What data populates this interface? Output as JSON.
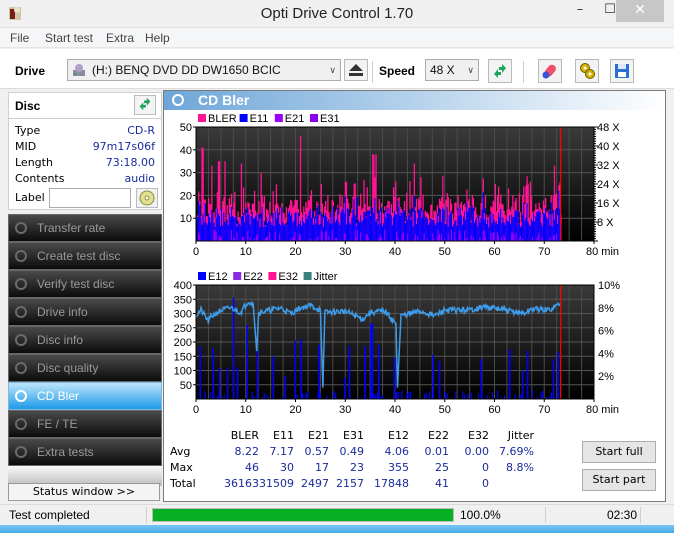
{
  "window": {
    "title": "Opti Drive Control 1.70",
    "minimize": "–",
    "maximize": "☐",
    "close": "✕"
  },
  "menu": [
    "File",
    "Start test",
    "Extra",
    "Help"
  ],
  "toolbar": {
    "drive_label": "Drive",
    "drive_value": "(H:)  BENQ DVD DD DW1650 BCIC",
    "speed_label": "Speed",
    "speed_value": "48 X"
  },
  "disc": {
    "header": "Disc",
    "rows": [
      {
        "key": "Type",
        "value": "CD-R"
      },
      {
        "key": "MID",
        "value": "97m17s06f"
      },
      {
        "key": "Length",
        "value": "73:18.00"
      },
      {
        "key": "Contents",
        "value": "audio"
      }
    ],
    "label_key": "Label",
    "label_value": ""
  },
  "nav": [
    {
      "label": "Transfer rate",
      "active": false
    },
    {
      "label": "Create test disc",
      "active": false
    },
    {
      "label": "Verify test disc",
      "active": false
    },
    {
      "label": "Drive info",
      "active": false
    },
    {
      "label": "Disc info",
      "active": false
    },
    {
      "label": "Disc quality",
      "active": false
    },
    {
      "label": "CD Bler",
      "active": true
    },
    {
      "label": "FE / TE",
      "active": false
    },
    {
      "label": "Extra tests",
      "active": false
    }
  ],
  "status_window_button": "Status window >>",
  "panel_title": "CD Bler",
  "colors": {
    "bler": "#ff1493",
    "e11": "#0000ff",
    "e21": "#9900ff",
    "e31": "#8800ee",
    "e12": "#0000ff",
    "e22": "#8a2be2",
    "e32": "#ff1493",
    "jitter": "#3d9be9",
    "jitter_legend": "#3b7f7f",
    "marker": "#ff0000",
    "progress": "#06b025"
  },
  "chart_data": [
    {
      "type": "bar",
      "title": "CD Bler - upper",
      "legend": [
        "BLER",
        "E11",
        "E21",
        "E31"
      ],
      "legend_placement": "top-left",
      "xlabel": "min",
      "x_ticks": [
        "0",
        "10",
        "20",
        "30",
        "40",
        "50",
        "60",
        "70",
        "80 min"
      ],
      "xlim": [
        0,
        80
      ],
      "y_ticks_left": [
        "10",
        "20",
        "30",
        "40",
        "50"
      ],
      "ylim_left": [
        0,
        50
      ],
      "y_ticks_right": [
        "8 X",
        "16 X",
        "24 X",
        "32 X",
        "40 X",
        "48 X"
      ],
      "ylim_right": [
        0,
        48
      ],
      "end_marker_min": 73.3,
      "grid": true,
      "series_summary": {
        "BLER_max": 46,
        "E11_max": 30,
        "E21_max": 17,
        "E31_max": 23,
        "BLER_avg": 8.22,
        "E11_avg": 7.17
      },
      "bler_peaks": [
        [
          1.2,
          41
        ],
        [
          3,
          33
        ],
        [
          4.5,
          35
        ],
        [
          5.8,
          35
        ],
        [
          9,
          34
        ],
        [
          13,
          30
        ],
        [
          20.8,
          46
        ],
        [
          30,
          26
        ],
        [
          35.5,
          38
        ],
        [
          36,
          38
        ],
        [
          45,
          28
        ],
        [
          60,
          25
        ],
        [
          67,
          26
        ],
        [
          72,
          33
        ]
      ]
    },
    {
      "type": "bar",
      "title": "CD Bler - lower",
      "legend": [
        "E12",
        "E22",
        "E32",
        "Jitter"
      ],
      "legend_placement": "top-left",
      "xlabel": "min",
      "x_ticks": [
        "0",
        "10",
        "20",
        "30",
        "40",
        "50",
        "60",
        "70",
        "80 min"
      ],
      "xlim": [
        0,
        80
      ],
      "y_ticks_left": [
        "50",
        "100",
        "150",
        "200",
        "250",
        "300",
        "350",
        "400"
      ],
      "ylim_left": [
        0,
        400
      ],
      "y_ticks_right": [
        "2%",
        "4%",
        "6%",
        "8%",
        "10%"
      ],
      "ylim_right": [
        0,
        10
      ],
      "end_marker_min": 73.3,
      "grid": true,
      "e12_spikes": [
        [
          0.7,
          185
        ],
        [
          3.3,
          178
        ],
        [
          4.6,
          110
        ],
        [
          6.2,
          110
        ],
        [
          7.4,
          355
        ],
        [
          8.2,
          110
        ],
        [
          10.1,
          260
        ],
        [
          12.2,
          170
        ],
        [
          15.4,
          150
        ],
        [
          17.8,
          80
        ],
        [
          19.8,
          205
        ],
        [
          21.0,
          210
        ],
        [
          24.6,
          190
        ],
        [
          29.8,
          75
        ],
        [
          30.7,
          185
        ],
        [
          33.8,
          185
        ],
        [
          35.0,
          265
        ],
        [
          35.3,
          265
        ],
        [
          36.6,
          190
        ],
        [
          39.7,
          145
        ],
        [
          47.5,
          155
        ],
        [
          48.8,
          135
        ],
        [
          57.2,
          140
        ],
        [
          62.9,
          175
        ],
        [
          65.5,
          100
        ],
        [
          66.5,
          170
        ],
        [
          71.7,
          140
        ],
        [
          72.6,
          165
        ]
      ],
      "jitter_percent": [
        [
          0,
          7.3
        ],
        [
          1,
          7.8
        ],
        [
          2.5,
          6.8
        ],
        [
          3,
          7.2
        ],
        [
          5,
          7.8
        ],
        [
          7,
          8.0
        ],
        [
          9,
          7.6
        ],
        [
          10.5,
          8.6
        ],
        [
          11.5,
          8.3
        ],
        [
          12.2,
          4.2
        ],
        [
          12.6,
          7.6
        ],
        [
          15,
          7.8
        ],
        [
          17,
          8.0
        ],
        [
          19,
          7.5
        ],
        [
          21,
          8.0
        ],
        [
          23,
          8.2
        ],
        [
          25,
          7.8
        ],
        [
          25.5,
          1.0
        ],
        [
          25.9,
          7.6
        ],
        [
          30,
          7.7
        ],
        [
          33.5,
          7.0
        ],
        [
          35,
          7.6
        ],
        [
          38,
          7.7
        ],
        [
          40.2,
          6.6
        ],
        [
          40.5,
          1.0
        ],
        [
          41.2,
          7.3
        ],
        [
          45,
          7.7
        ],
        [
          48,
          7.3
        ],
        [
          50,
          7.8
        ],
        [
          55,
          7.8
        ],
        [
          58,
          8.1
        ],
        [
          62,
          7.8
        ],
        [
          66,
          7.5
        ],
        [
          67.5,
          7.9
        ],
        [
          71,
          7.8
        ],
        [
          73.3,
          8.4
        ]
      ],
      "series_summary": {
        "E12_max": 355,
        "E22_max": 25,
        "E32_max": 0,
        "Jitter_avg_percent": 7.69,
        "Jitter_max_percent": 8.8
      }
    }
  ],
  "stats": {
    "columns": [
      "BLER",
      "E11",
      "E21",
      "E31",
      "E12",
      "E22",
      "E32",
      "Jitter"
    ],
    "rows": [
      {
        "label": "Avg",
        "values": [
          "8.22",
          "7.17",
          "0.57",
          "0.49",
          "4.06",
          "0.01",
          "0.00",
          "7.69%"
        ]
      },
      {
        "label": "Max",
        "values": [
          "46",
          "30",
          "17",
          "23",
          "355",
          "25",
          "0",
          "8.8%"
        ]
      },
      {
        "label": "Total",
        "values": [
          "36163",
          "31509",
          "2497",
          "2157",
          "17848",
          "41",
          "0",
          ""
        ]
      }
    ]
  },
  "buttons": {
    "start_full": "Start full",
    "start_part": "Start part"
  },
  "statusbar": {
    "text": "Test completed",
    "progress": 1.0,
    "progress_label": "100.0%",
    "time": "02:30"
  }
}
